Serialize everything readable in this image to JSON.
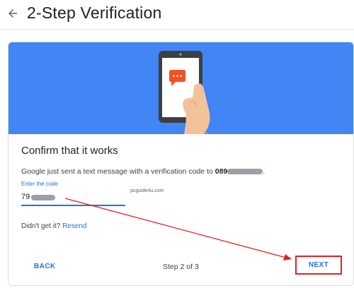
{
  "header": {
    "title": "2-Step Verification",
    "back_icon": "arrow-left-icon"
  },
  "card": {
    "banner_illustration": "phone-sms-illustration",
    "title": "Confirm that it works",
    "message_prefix": "Google just sent a text message with a verification code to ",
    "phone_visible": "089",
    "message_suffix": ".",
    "code_label": "Enter the code",
    "code_value_visible": "79",
    "no_code_text": "Didn't get it?",
    "resend_label": "Resend",
    "back_label": "BACK",
    "step_text": "Step 2 of 3",
    "next_label": "NEXT"
  },
  "watermark": "pcguide4u.com",
  "colors": {
    "accent": "#1a73e8",
    "banner": "#4285f4",
    "annotation": "#e02020",
    "redaction": "#9aa0a6"
  }
}
